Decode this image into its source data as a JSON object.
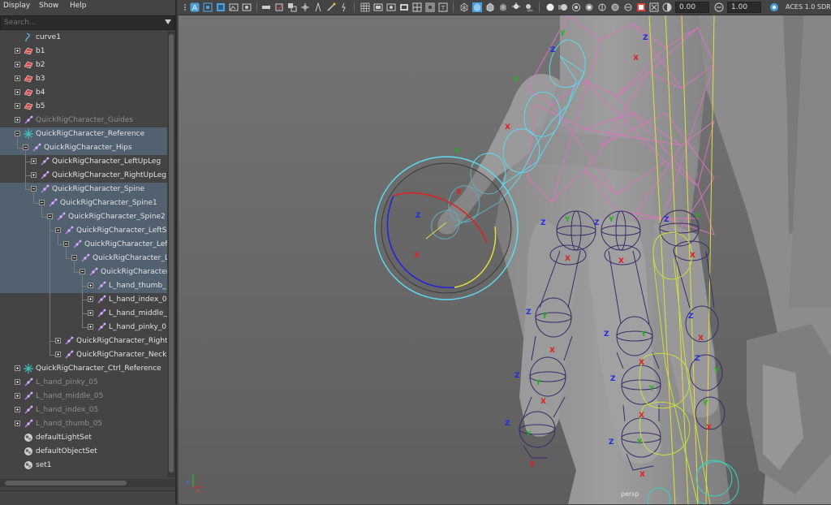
{
  "menu": {
    "display": "Display",
    "show": "Show",
    "help": "Help"
  },
  "search": {
    "placeholder": "Search..."
  },
  "outliner": {
    "items": [
      {
        "label": "curve1",
        "depth": 0,
        "icon": "curve",
        "expander": "none",
        "dim": false,
        "selected": false
      },
      {
        "label": "b1",
        "depth": 0,
        "icon": "mesh",
        "expander": "plus",
        "dim": false,
        "selected": false
      },
      {
        "label": "b2",
        "depth": 0,
        "icon": "mesh",
        "expander": "plus",
        "dim": false,
        "selected": false
      },
      {
        "label": "b3",
        "depth": 0,
        "icon": "mesh",
        "expander": "plus",
        "dim": false,
        "selected": false
      },
      {
        "label": "b4",
        "depth": 0,
        "icon": "mesh",
        "expander": "plus",
        "dim": false,
        "selected": false
      },
      {
        "label": "b5",
        "depth": 0,
        "icon": "mesh",
        "expander": "plus",
        "dim": false,
        "selected": false
      },
      {
        "label": "QuickRigCharacter_Guides",
        "depth": 0,
        "icon": "joint",
        "expander": "plus",
        "dim": true,
        "selected": false
      },
      {
        "label": "QuickRigCharacter_Reference",
        "depth": 0,
        "icon": "locator",
        "expander": "minus",
        "dim": false,
        "selected": true
      },
      {
        "label": "QuickRigCharacter_Hips",
        "depth": 1,
        "icon": "joint",
        "expander": "minus",
        "dim": false,
        "selected": true
      },
      {
        "label": "QuickRigCharacter_LeftUpLeg",
        "depth": 2,
        "icon": "joint",
        "expander": "plus",
        "dim": false,
        "selected": false
      },
      {
        "label": "QuickRigCharacter_RightUpLeg",
        "depth": 2,
        "icon": "joint",
        "expander": "plus",
        "dim": false,
        "selected": false
      },
      {
        "label": "QuickRigCharacter_Spine",
        "depth": 2,
        "icon": "joint",
        "expander": "minus",
        "dim": false,
        "selected": true
      },
      {
        "label": "QuickRigCharacter_Spine1",
        "depth": 3,
        "icon": "joint",
        "expander": "minus",
        "dim": false,
        "selected": true
      },
      {
        "label": "QuickRigCharacter_Spine2",
        "depth": 4,
        "icon": "joint",
        "expander": "minus",
        "dim": false,
        "selected": true
      },
      {
        "label": "QuickRigCharacter_LeftSh",
        "depth": 5,
        "icon": "joint",
        "expander": "minus",
        "dim": false,
        "selected": true
      },
      {
        "label": "QuickRigCharacter_Left",
        "depth": 6,
        "icon": "joint",
        "expander": "minus",
        "dim": false,
        "selected": true
      },
      {
        "label": "QuickRigCharacter_L",
        "depth": 7,
        "icon": "joint",
        "expander": "minus",
        "dim": false,
        "selected": true
      },
      {
        "label": "QuickRigCharacter",
        "depth": 8,
        "icon": "joint",
        "expander": "minus",
        "dim": false,
        "selected": true
      },
      {
        "label": "L_hand_thumb_",
        "depth": 9,
        "icon": "joint",
        "expander": "plus",
        "dim": false,
        "selected": true
      },
      {
        "label": "L_hand_index_0",
        "depth": 9,
        "icon": "joint",
        "expander": "plus",
        "dim": false,
        "selected": false
      },
      {
        "label": "L_hand_middle_",
        "depth": 9,
        "icon": "joint",
        "expander": "plus",
        "dim": false,
        "selected": false
      },
      {
        "label": "L_hand_pinky_0",
        "depth": 9,
        "icon": "joint",
        "expander": "plus",
        "dim": false,
        "selected": false
      },
      {
        "label": "QuickRigCharacter_Right",
        "depth": 5,
        "icon": "joint",
        "expander": "plus",
        "dim": false,
        "selected": false
      },
      {
        "label": "QuickRigCharacter_Neck",
        "depth": 5,
        "icon": "joint",
        "expander": "plus",
        "dim": false,
        "selected": false
      },
      {
        "label": "QuickRigCharacter_Ctrl_Reference",
        "depth": 0,
        "icon": "locator",
        "expander": "plus",
        "dim": false,
        "selected": false
      },
      {
        "label": "L_hand_pinky_05",
        "depth": 0,
        "icon": "joint",
        "expander": "plus",
        "dim": true,
        "selected": false
      },
      {
        "label": "L_hand_middle_05",
        "depth": 0,
        "icon": "joint",
        "expander": "plus",
        "dim": true,
        "selected": false
      },
      {
        "label": "L_hand_index_05",
        "depth": 0,
        "icon": "joint",
        "expander": "plus",
        "dim": true,
        "selected": false
      },
      {
        "label": "L_hand_thumb_05",
        "depth": 0,
        "icon": "joint",
        "expander": "plus",
        "dim": true,
        "selected": false
      },
      {
        "label": "defaultLightSet",
        "depth": 0,
        "icon": "set",
        "expander": "none",
        "dim": false,
        "selected": false
      },
      {
        "label": "defaultObjectSet",
        "depth": 0,
        "icon": "set",
        "expander": "none",
        "dim": false,
        "selected": false
      },
      {
        "label": "set1",
        "depth": 0,
        "icon": "set",
        "expander": "none",
        "dim": false,
        "selected": false
      }
    ]
  },
  "toolbar": {
    "exposure_value": "0.00",
    "gamma_value": "1.00",
    "color_space": "ACES 1.0 SDR"
  },
  "viewport": {
    "camera_label": "persp",
    "axis_z": "z",
    "axis_x": "x",
    "labels": {
      "x": "X",
      "y": "Y",
      "z": "Z"
    }
  },
  "colors": {
    "selection": "#526170",
    "joint": "#b07ad8",
    "locator": "#3fc0c0",
    "wire_cyan": "#5fd8f0",
    "wire_pink": "#e070c0",
    "wire_yellow": "#e0e040",
    "joint_purple": "#3a2a6a"
  }
}
